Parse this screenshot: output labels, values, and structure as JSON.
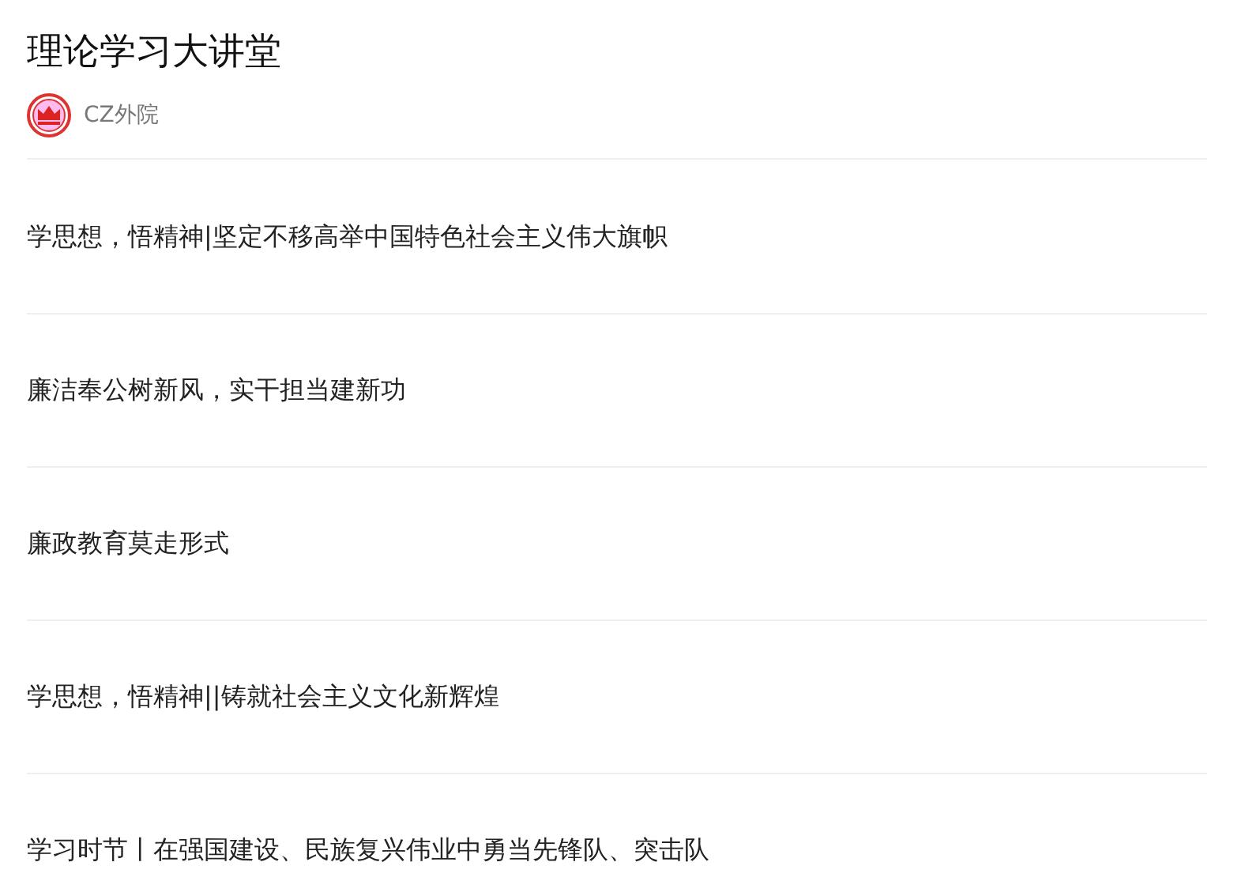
{
  "title": "理论学习大讲堂",
  "account": {
    "name": "CZ外院"
  },
  "articles": [
    {
      "title": "学思想，悟精神|坚定不移高举中国特色社会主义伟大旗帜"
    },
    {
      "title": "廉洁奉公树新风，实干担当建新功"
    },
    {
      "title": "廉政教育莫走形式"
    },
    {
      "title": "学思想，悟精神||铸就社会主义文化新辉煌"
    },
    {
      "title": "学习时节丨在强国建设、民族复兴伟业中勇当先锋队、突击队"
    }
  ]
}
